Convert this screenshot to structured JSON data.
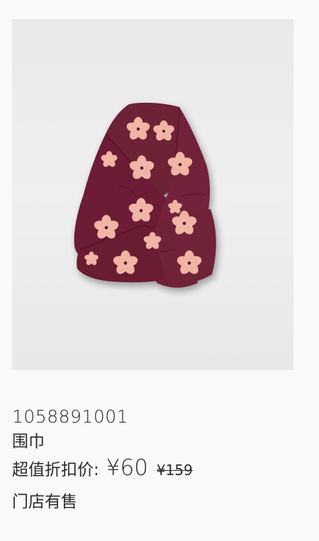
{
  "product": {
    "sku": "1058891001",
    "name": "围巾",
    "price_label": "超值折扣价:",
    "price_current": "¥60",
    "price_original": "¥159",
    "availability": "门店有售"
  },
  "colors": {
    "page_background": "#faf9f7",
    "image_background": "#ececec",
    "scarf_base": "#6b1f33",
    "flower": "#f2b6a8",
    "flower_center": "#5a1528",
    "text": "#2a2a2a"
  }
}
